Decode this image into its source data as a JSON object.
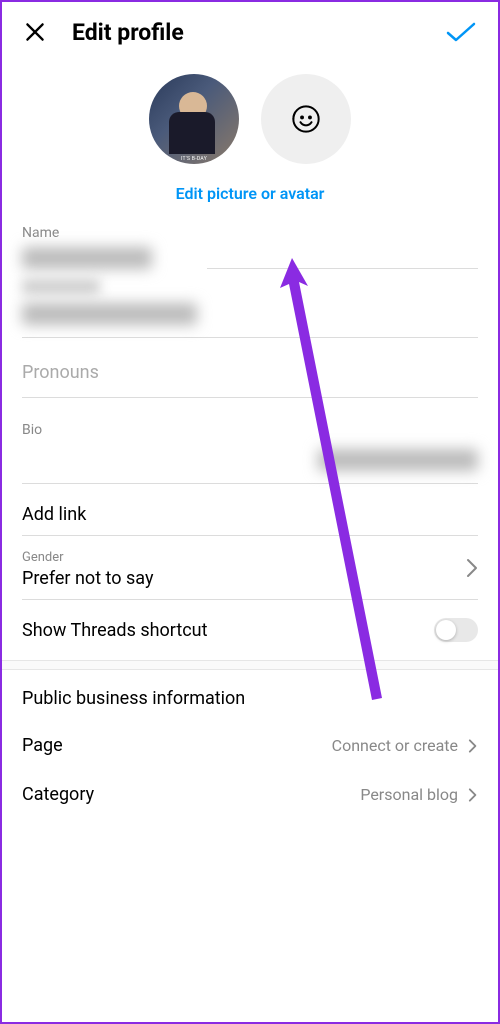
{
  "header": {
    "title": "Edit profile"
  },
  "avatar": {
    "edit_link": "Edit picture or avatar"
  },
  "fields": {
    "name_label": "Name",
    "pronouns_label": "Pronouns",
    "bio_label": "Bio",
    "add_link": "Add link",
    "gender_label": "Gender",
    "gender_value": "Prefer not to say",
    "threads_label": "Show Threads shortcut"
  },
  "business": {
    "header": "Public business information",
    "page_label": "Page",
    "page_value": "Connect or create",
    "category_label": "Category",
    "category_value": "Personal blog"
  }
}
